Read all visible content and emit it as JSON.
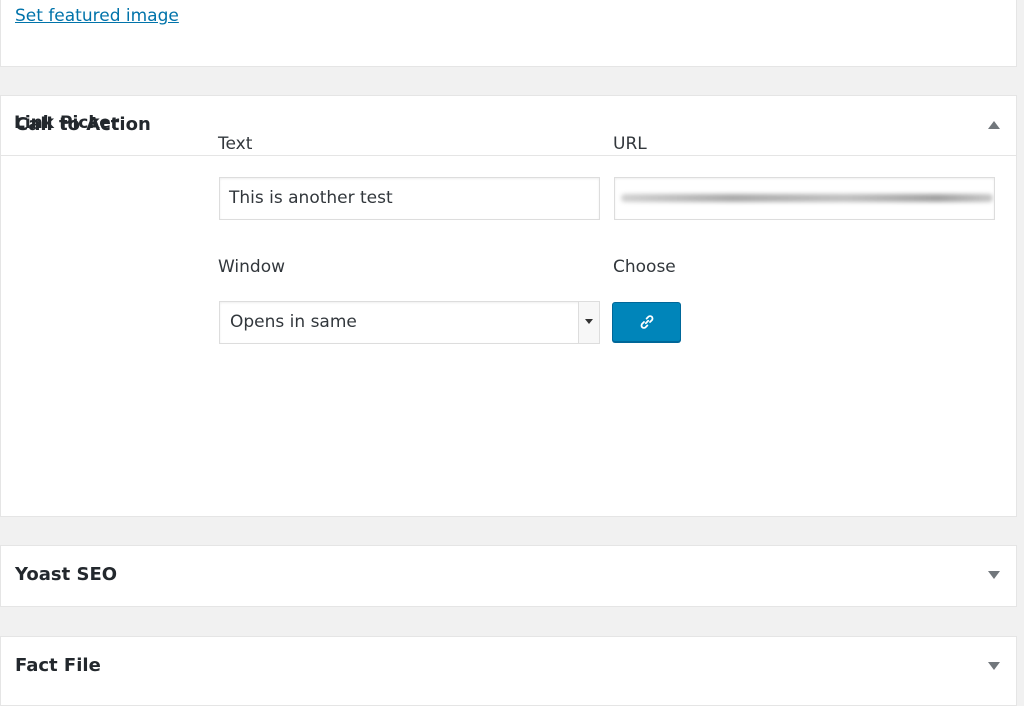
{
  "featured": {
    "link_text": "Set featured image"
  },
  "cta": {
    "title": "Call to Action",
    "field_label": "Link Picker",
    "text_label": "Text",
    "text_value": "This is another test",
    "url_label": "URL",
    "window_label": "Window",
    "window_value": "Opens in same",
    "choose_label": "Choose",
    "choose_icon": "link-icon"
  },
  "yoast": {
    "title": "Yoast SEO"
  },
  "fact": {
    "title": "Fact File"
  },
  "colors": {
    "accent": "#0085ba",
    "link": "#0073aa",
    "background": "#f1f1f1"
  }
}
